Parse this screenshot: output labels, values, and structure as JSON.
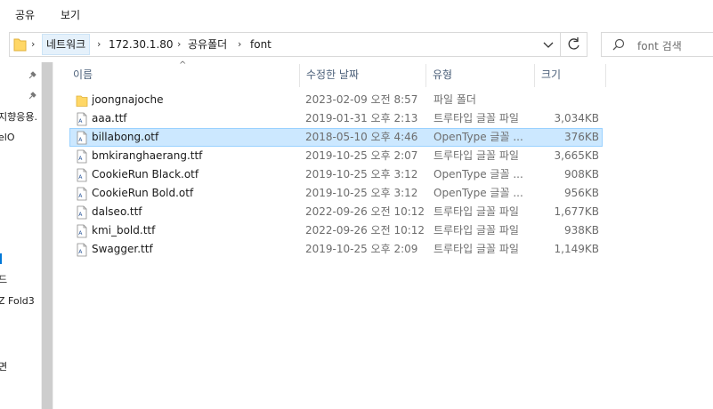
{
  "ribbon": {
    "tab_share": "공유",
    "tab_view": "보기"
  },
  "address": {
    "crumbs": [
      "네트워크",
      "172.30.1.80",
      "공유폴더",
      "font"
    ],
    "dropdown_icon": "chevron-down-icon",
    "refresh_icon": "refresh-icon"
  },
  "search": {
    "placeholder": "font 검색",
    "icon": "search-icon"
  },
  "nav": {
    "items": [
      "지향응용.",
      "elO",
      "드",
      "Z Fold3",
      "면"
    ]
  },
  "columns": {
    "name": "이름",
    "date": "수정한 날짜",
    "type": "유형",
    "size": "크기"
  },
  "files": [
    {
      "name": "joongnajoche",
      "date": "2023-02-09 오전 8:57",
      "type": "파일 폴더",
      "size": "",
      "icon": "folder-icon"
    },
    {
      "name": "aaa.ttf",
      "date": "2019-01-31 오후 2:13",
      "type": "트루타입 글꼴 파일",
      "size": "3,034KB",
      "icon": "font-file-icon"
    },
    {
      "name": "billabong.otf",
      "date": "2018-05-10 오후 4:46",
      "type": "OpenType 글꼴 ...",
      "size": "376KB",
      "icon": "font-file-icon",
      "selected": true
    },
    {
      "name": "bmkiranghaerang.ttf",
      "date": "2019-10-25 오후 2:07",
      "type": "트루타입 글꼴 파일",
      "size": "3,665KB",
      "icon": "font-file-icon"
    },
    {
      "name": "CookieRun Black.otf",
      "date": "2019-10-25 오후 3:12",
      "type": "OpenType 글꼴 ...",
      "size": "908KB",
      "icon": "font-file-icon"
    },
    {
      "name": "CookieRun Bold.otf",
      "date": "2019-10-25 오후 3:12",
      "type": "OpenType 글꼴 ...",
      "size": "956KB",
      "icon": "font-file-icon"
    },
    {
      "name": "dalseo.ttf",
      "date": "2022-09-26 오전 10:12",
      "type": "트루타입 글꼴 파일",
      "size": "1,677KB",
      "icon": "font-file-icon"
    },
    {
      "name": "kmi_bold.ttf",
      "date": "2022-09-26 오전 10:12",
      "type": "트루타입 글꼴 파일",
      "size": "938KB",
      "icon": "font-file-icon"
    },
    {
      "name": "Swagger.ttf",
      "date": "2019-10-25 오후 2:09",
      "type": "트루타입 글꼴 파일",
      "size": "1,149KB",
      "icon": "font-file-icon"
    }
  ],
  "colors": {
    "selection": "#cce8ff",
    "selection_border": "#99d1ff",
    "header_text": "#4c607a",
    "accent": "#0078d7"
  }
}
